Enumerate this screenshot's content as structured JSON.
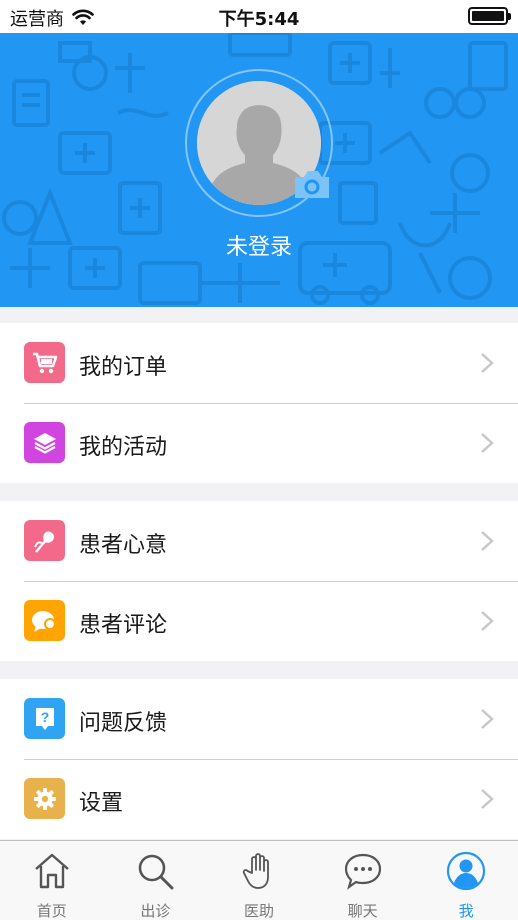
{
  "status_bar": {
    "carrier": "运营商",
    "time": "下午5:44"
  },
  "profile": {
    "login_status": "未登录"
  },
  "menu": {
    "groups": [
      {
        "items": [
          {
            "label": "我的订单",
            "icon": "cart-icon",
            "color": "#f2698a"
          },
          {
            "label": "我的活动",
            "icon": "layers-icon",
            "color": "#d044e0"
          }
        ]
      },
      {
        "items": [
          {
            "label": "患者心意",
            "icon": "flower-icon",
            "color": "#f2698a"
          },
          {
            "label": "患者评论",
            "icon": "chat-bubble-icon",
            "color": "#ffa400"
          }
        ]
      },
      {
        "items": [
          {
            "label": "问题反馈",
            "icon": "question-icon",
            "color": "#2ea4f2"
          },
          {
            "label": "设置",
            "icon": "gear-icon",
            "color": "#e8b14b"
          }
        ]
      }
    ]
  },
  "tab_bar": {
    "tabs": [
      {
        "label": "首页",
        "icon": "home-icon"
      },
      {
        "label": "出诊",
        "icon": "search-icon"
      },
      {
        "label": "医助",
        "icon": "hand-icon"
      },
      {
        "label": "聊天",
        "icon": "chat-icon"
      },
      {
        "label": "我",
        "icon": "user-icon",
        "active": true
      }
    ]
  },
  "colors": {
    "header_blue": "#2196f3",
    "active_tab": "#2196f3"
  }
}
